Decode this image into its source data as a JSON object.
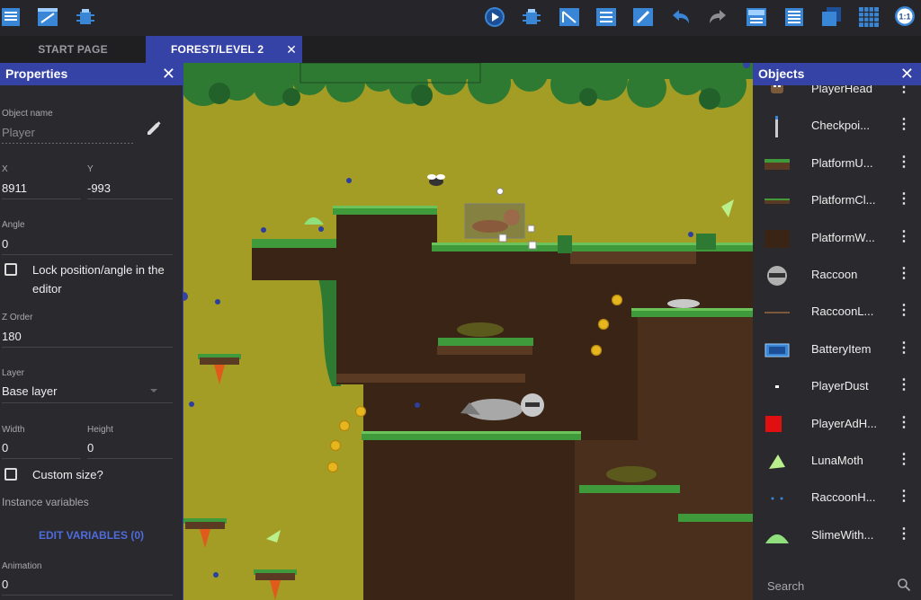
{
  "toolbar": {
    "icons": [
      "project-manager-icon",
      "scene-editor-icon",
      "debugger-icon",
      "preview-icon",
      "debug-preview-icon",
      "object-editor-icon",
      "layers-icon",
      "instances-icon",
      "edit-icon",
      "undo-icon",
      "redo-icon",
      "properties-icon",
      "objects-list-icon",
      "zorder-icon",
      "grid-icon",
      "zoom-reset-icon"
    ],
    "zoom_label": "1:1"
  },
  "tabs": [
    {
      "label": "START PAGE"
    },
    {
      "label": "FOREST/LEVEL 2",
      "close": "✕"
    }
  ],
  "properties": {
    "title": "Properties",
    "close": "✕",
    "object_name_label": "Object name",
    "object_name_placeholder": "Player",
    "x_label": "X",
    "x_value": "8911",
    "y_label": "Y",
    "y_value": "-993",
    "angle_label": "Angle",
    "angle_value": "0",
    "lock_label": "Lock position/angle in the editor",
    "zorder_label": "Z Order",
    "zorder_value": "180",
    "layer_label": "Layer",
    "layer_value": "Base layer",
    "width_label": "Width",
    "width_value": "0",
    "height_label": "Height",
    "height_value": "0",
    "custom_size_label": "Custom size?",
    "instance_vars_label": "Instance variables",
    "edit_vars": "EDIT VARIABLES (0)",
    "animation_label": "Animation",
    "animation_value": "0"
  },
  "objects": {
    "title": "Objects",
    "close": "✕",
    "items": [
      {
        "name": "PlayerHead",
        "icon": "player-head-icon"
      },
      {
        "name": "Checkpoi...",
        "icon": "checkpoint-icon"
      },
      {
        "name": "PlatformU...",
        "icon": "platform-u-icon"
      },
      {
        "name": "PlatformCl...",
        "icon": "platform-cl-icon"
      },
      {
        "name": "PlatformW...",
        "icon": "platform-w-icon"
      },
      {
        "name": "Raccoon",
        "icon": "raccoon-icon"
      },
      {
        "name": "RaccoonL...",
        "icon": "raccoon-l-icon"
      },
      {
        "name": "BatteryItem",
        "icon": "battery-icon"
      },
      {
        "name": "PlayerDust",
        "icon": "player-dust-icon"
      },
      {
        "name": "PlayerAdH...",
        "icon": "player-adh-icon"
      },
      {
        "name": "LunaMoth",
        "icon": "luna-moth-icon"
      },
      {
        "name": "RaccoonH...",
        "icon": "raccoon-h-icon"
      },
      {
        "name": "SlimeWith...",
        "icon": "slime-icon"
      }
    ],
    "menu_glyph": "⋮",
    "search_placeholder": "Search"
  },
  "colors": {
    "accent": "#3542a6",
    "sky": "#a49d25",
    "dirt": "#3a2416",
    "grass": "#3e9a3a",
    "coin": "#e6b61f"
  }
}
